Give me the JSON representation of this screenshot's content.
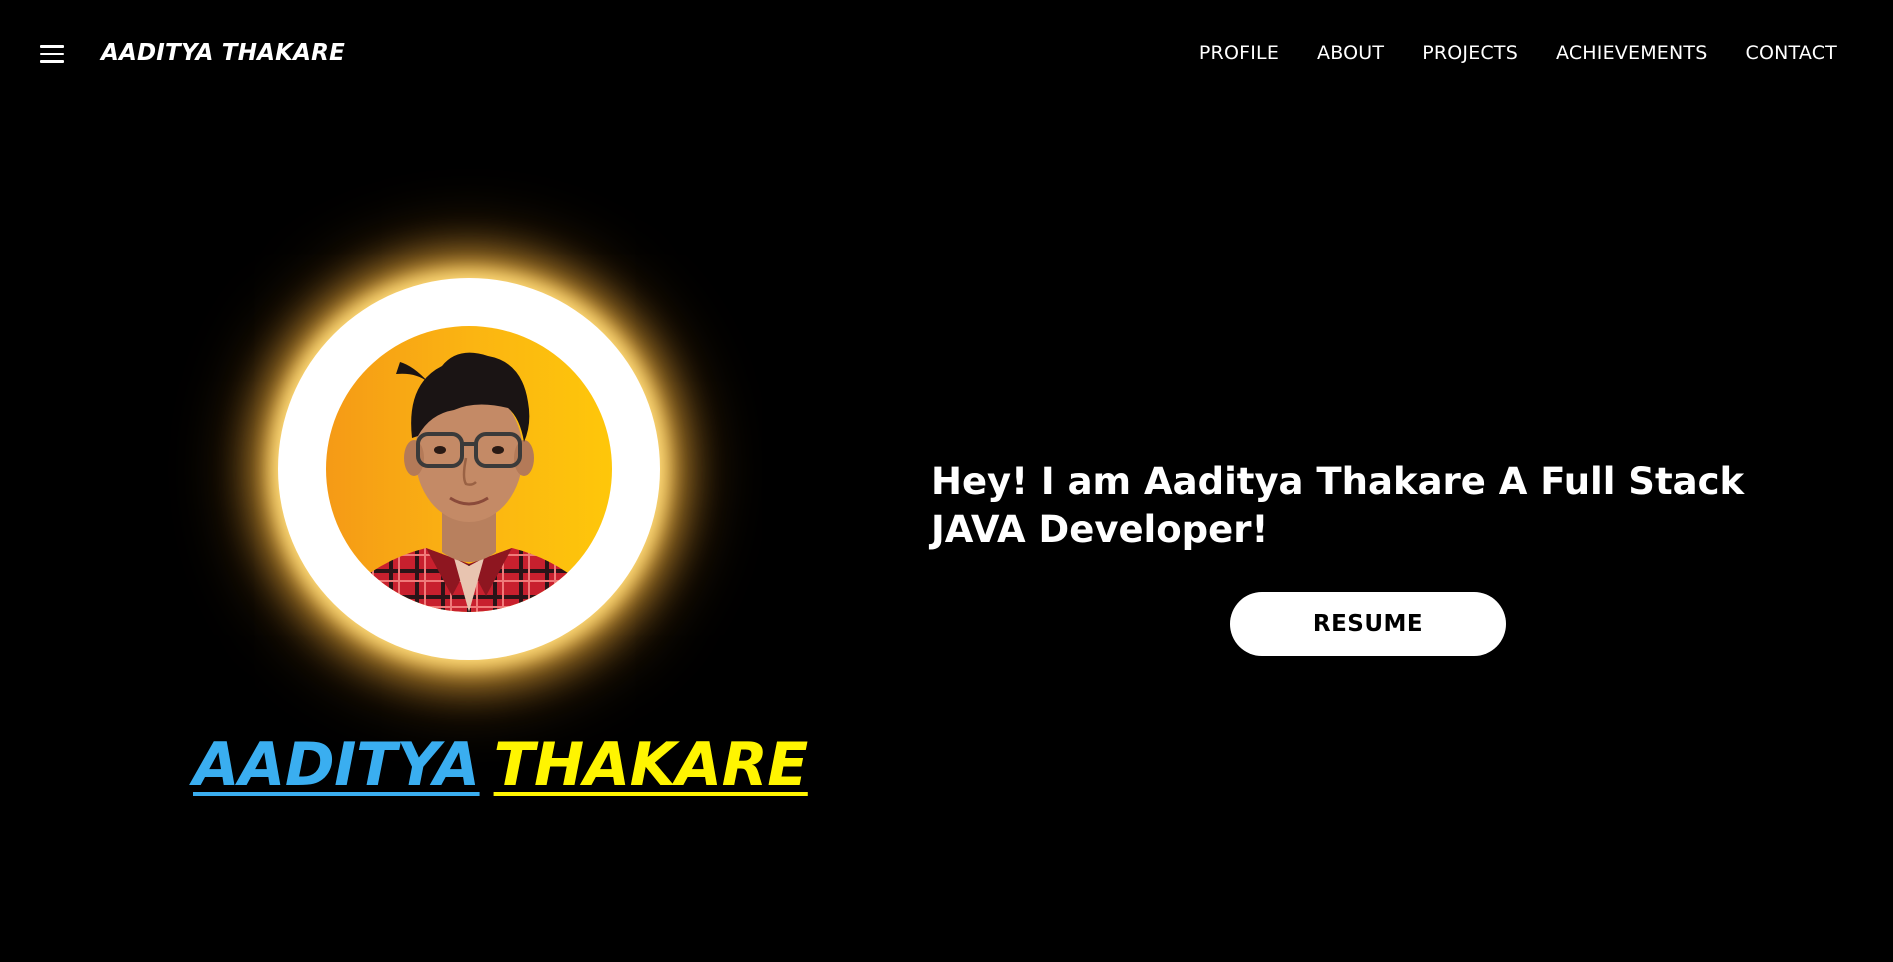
{
  "header": {
    "menu_icon": "hamburger-menu-icon",
    "brand": "AADITYA THAKARE",
    "nav": [
      {
        "label": "PROFILE"
      },
      {
        "label": "ABOUT"
      },
      {
        "label": "PROJECTS"
      },
      {
        "label": "ACHIEVEMENTS"
      },
      {
        "label": "CONTACT"
      }
    ]
  },
  "hero": {
    "first_name": "AADITYA",
    "last_name": "THAKARE",
    "intro": "Hey! I am Aaditya Thakare A Full Stack JAVA Developer!",
    "resume_label": "RESUME"
  },
  "colors": {
    "background": "#000000",
    "first_name": "#3aaef0",
    "last_name": "#fff500",
    "avatar_ring_glow": "#ffc34a",
    "avatar_bg": "#fbb412"
  }
}
